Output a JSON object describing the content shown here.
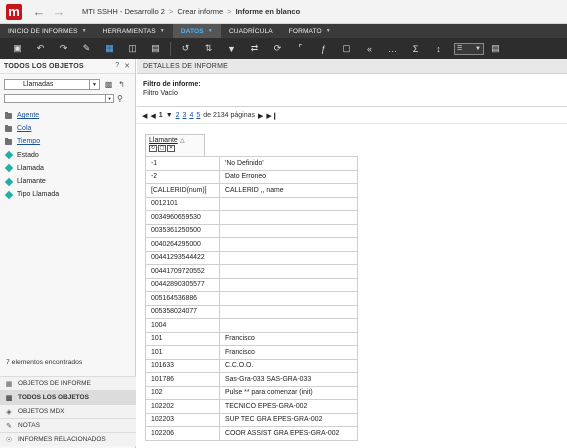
{
  "window": {
    "title_path": [
      "MTI SSHH - Desarrollo 2",
      "Crear informe",
      "Informe en blanco"
    ]
  },
  "menu": {
    "items": [
      {
        "label": "INICIO DE INFORMES",
        "has_caret": true,
        "active": false
      },
      {
        "label": "HERRAMIENTAS",
        "has_caret": true,
        "active": false
      },
      {
        "label": "DATOS",
        "has_caret": true,
        "active": true
      },
      {
        "label": "CUADRÍCULA",
        "has_caret": false,
        "active": false
      },
      {
        "label": "FORMATO",
        "has_caret": true,
        "active": false
      }
    ]
  },
  "toolbar": {
    "icons": [
      "save-icon",
      "undo-icon",
      "redo-icon",
      "edit-icon",
      "grid-view-icon",
      "grid-graph-icon",
      "graph-view-icon",
      "pivot-icon",
      "sort-icon",
      "filter-icon",
      "swap-icon",
      "refresh-icon",
      "subtotals-icon",
      "formula-icon",
      "hide-icon",
      "drill-icon",
      "more-icon",
      "sum-icon",
      "collapse-icon",
      "tile-icon"
    ]
  },
  "left_panel": {
    "title": "TODOS LOS OBJETOS",
    "selected_object": "Llamadas",
    "search_value": "",
    "tree": [
      {
        "label": "Agente",
        "type": "folder",
        "link": true
      },
      {
        "label": "Cola",
        "type": "folder",
        "link": true
      },
      {
        "label": "Tiempo",
        "type": "folder",
        "link": true
      },
      {
        "label": "Estado",
        "type": "attribute",
        "link": false
      },
      {
        "label": "Llamada",
        "type": "attribute",
        "link": false
      },
      {
        "label": "Llamante",
        "type": "attribute",
        "link": false
      },
      {
        "label": "Tipo Llamada",
        "type": "attribute",
        "link": false
      }
    ],
    "found_text": "7 elementos encontrados",
    "tabs": [
      {
        "label": "OBJETOS DE INFORME",
        "icon": "report-objects-icon",
        "active": false
      },
      {
        "label": "TODOS LOS OBJETOS",
        "icon": "all-objects-icon",
        "active": true
      },
      {
        "label": "OBJETOS MDX",
        "icon": "mdx-icon",
        "active": false
      },
      {
        "label": "NOTAS",
        "icon": "notes-icon",
        "active": false
      },
      {
        "label": "INFORMES RELACIONADOS",
        "icon": "related-icon",
        "active": false
      }
    ]
  },
  "details": {
    "header": "DETALLES DE INFORME",
    "filter_label": "Filtro de informe:",
    "filter_value": "Filtro Vacío"
  },
  "pager": {
    "current": "1",
    "pages": [
      "2",
      "3",
      "4",
      "5"
    ],
    "total_text": "de 2134 páginas"
  },
  "grid": {
    "column_header": "Llamante",
    "rows": [
      [
        "-1",
        "'No Definido'"
      ],
      [
        "-2",
        "Dato Erroneo"
      ],
      [
        "[CALLERID(num)]",
        "CALLERID ,, name"
      ],
      [
        "0012101",
        ""
      ],
      [
        "0034960659530",
        ""
      ],
      [
        "0035361250500",
        ""
      ],
      [
        "0040264295000",
        ""
      ],
      [
        "00441293544422",
        ""
      ],
      [
        "00441709720552",
        ""
      ],
      [
        "00442890305577",
        ""
      ],
      [
        "005164536886",
        ""
      ],
      [
        "005358024077",
        ""
      ],
      [
        "1004",
        ""
      ],
      [
        "101",
        "Francisco"
      ],
      [
        "101",
        "Francisco"
      ],
      [
        "101633",
        "C.C.O.O."
      ],
      [
        "101786",
        "Sas-Gra-033 SAS-GRA-033"
      ],
      [
        "102",
        "Pulse ** para comenzar (init)"
      ],
      [
        "102202",
        "TECNICO EPES-GRA-002"
      ],
      [
        "102203",
        "SUP TEC GRA EPES-GRA-002"
      ],
      [
        "102206",
        "COOR ASSIST GRA EPES-GRA-002"
      ]
    ]
  }
}
